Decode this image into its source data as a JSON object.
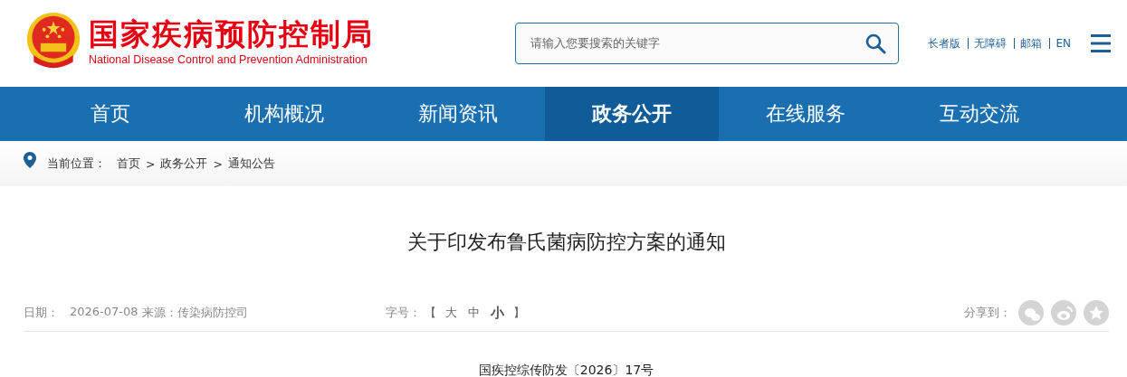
{
  "header": {
    "title": "国家疾病预防控制局",
    "subtitle": "National Disease Control and Prevention Administration",
    "search": {
      "placeholder": "请输入您要搜索的关键字"
    },
    "links": [
      "长者版",
      "无障碍",
      "邮箱",
      "EN"
    ]
  },
  "nav": [
    {
      "label": "首页",
      "selected": false
    },
    {
      "label": "机构概况",
      "selected": false
    },
    {
      "label": "新闻资讯",
      "selected": false
    },
    {
      "label": "政务公开",
      "selected": true
    },
    {
      "label": "在线服务",
      "selected": false
    },
    {
      "label": "互动交流",
      "selected": false
    }
  ],
  "breadcrumb": {
    "label": "当前位置：",
    "items": [
      "首页",
      "政务公开",
      "通知公告"
    ],
    "separator": ">"
  },
  "article": {
    "title": "关于印发布鲁氏菌病防控方案的通知",
    "date_label": "日期：",
    "date": "2026-07-08",
    "source": "来源：传染病防控司",
    "font_label": "字号：",
    "bracket_open": "【",
    "bracket_close": "】",
    "font_sizes": [
      {
        "label": "大",
        "selected": false
      },
      {
        "label": "中",
        "selected": false
      },
      {
        "label": "小",
        "selected": true
      }
    ],
    "share_label": "分享到：",
    "share": [
      {
        "kind": "wechat"
      },
      {
        "kind": "weibo"
      },
      {
        "kind": "favorite"
      }
    ],
    "doc_number": "国疾控综传防发〔2026〕17号"
  }
}
